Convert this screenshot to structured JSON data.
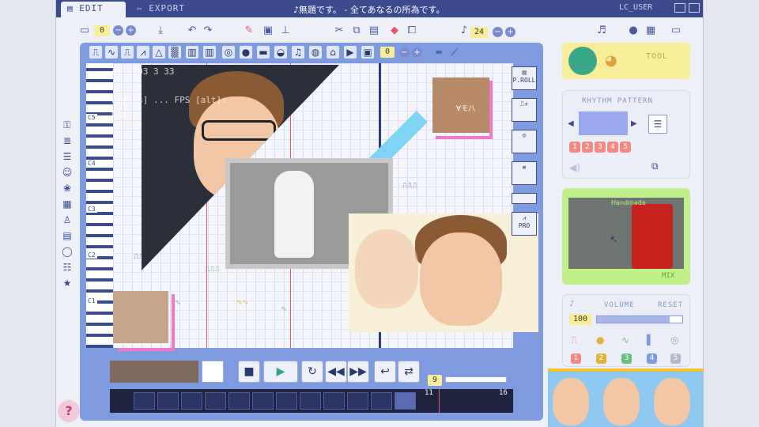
{
  "tabs": {
    "edit": "EDIT",
    "export": "EXPORT"
  },
  "title": "♪無題です。 - 全てあなるの所為です。",
  "user": "LC_USER",
  "toolbar": {
    "undo_count": "0",
    "tempo": "24",
    "instrument_counter": "0",
    "plus": "+",
    "minus": "−"
  },
  "roll": {
    "octaves": [
      "C5",
      "C4",
      "C3",
      "C2",
      "C1"
    ],
    "overlay_lines": [
      "at   -103   3   33",
      "Pie [s] ... FPS [alt]:",
      "C1p p"
    ],
    "note_markers": [
      "⎍⎍⎍⎍",
      "⎍⎍⎍",
      "∿",
      "∿∿",
      "∿",
      "⎍⎍⎍"
    ]
  },
  "side_tools": {
    "proll": "P.ROLL",
    "pro": "PRO"
  },
  "transport": {
    "measure": "9",
    "seq_start": "11",
    "seq_end": "16"
  },
  "right": {
    "tool_label": "TOOL",
    "rhythm_title": "RHYTHM PATTERN",
    "rhythm_numbers": [
      "1",
      "2",
      "3",
      "4",
      "5"
    ],
    "preview_mix": "MIX",
    "volume_title": "VOLUME",
    "volume_reset": "RESET",
    "volume_value": "100",
    "volume_level": 0.85,
    "channel_numbers": [
      "1",
      "2",
      "3",
      "4",
      "5"
    ]
  },
  "overlays": {
    "small_caption": "∀モ八",
    "handwave": "Handmade"
  },
  "help": "?",
  "colors": {
    "frame": "#3a4a8c",
    "panel": "#7f9be0",
    "tool": "#f8ee9a",
    "preview": "#bff08a",
    "pink": "#f07ac8",
    "stripe": "#7fd4f5"
  }
}
